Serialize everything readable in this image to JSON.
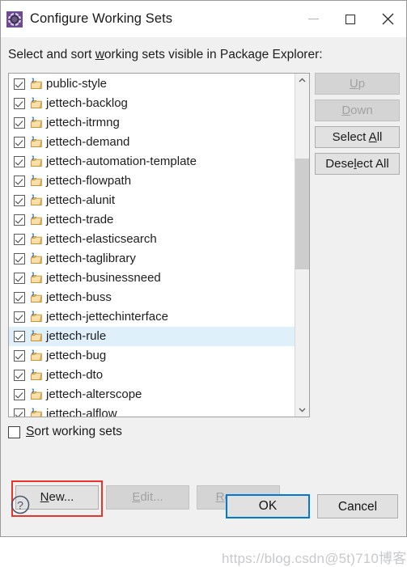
{
  "window": {
    "title": "Configure Working Sets",
    "icon": "gear-icon",
    "controls": {
      "minimize": "minimize-icon",
      "maximize": "maximize-icon",
      "close": "close-icon"
    }
  },
  "prompt": {
    "before": "Select and sort ",
    "mnemonic": "w",
    "after": "orking sets visible in Package Explorer:"
  },
  "list": {
    "items": [
      {
        "label": "public-style",
        "checked": true,
        "selected": false
      },
      {
        "label": "jettech-backlog",
        "checked": true,
        "selected": false
      },
      {
        "label": "jettech-itrmng",
        "checked": true,
        "selected": false
      },
      {
        "label": "jettech-demand",
        "checked": true,
        "selected": false
      },
      {
        "label": "jettech-automation-template",
        "checked": true,
        "selected": false
      },
      {
        "label": "jettech-flowpath",
        "checked": true,
        "selected": false
      },
      {
        "label": "jettech-alunit",
        "checked": true,
        "selected": false
      },
      {
        "label": "jettech-trade",
        "checked": true,
        "selected": false
      },
      {
        "label": "jettech-elasticsearch",
        "checked": true,
        "selected": false
      },
      {
        "label": "jettech-taglibrary",
        "checked": true,
        "selected": false
      },
      {
        "label": "jettech-businessneed",
        "checked": true,
        "selected": false
      },
      {
        "label": "jettech-buss",
        "checked": true,
        "selected": false
      },
      {
        "label": "jettech-jettechinterface",
        "checked": true,
        "selected": false
      },
      {
        "label": "jettech-rule",
        "checked": true,
        "selected": true
      },
      {
        "label": "jettech-bug",
        "checked": true,
        "selected": false
      },
      {
        "label": "jettech-dto",
        "checked": true,
        "selected": false
      },
      {
        "label": "jettech-alterscope",
        "checked": true,
        "selected": false
      },
      {
        "label": "jettech-alflow",
        "checked": true,
        "selected": false
      }
    ],
    "item_icon": "java-working-set-folder-icon",
    "scrollbar": {
      "up_arrow": "chevron-up-icon",
      "down_arrow": "chevron-down-icon"
    }
  },
  "side_buttons": [
    {
      "label_before": "",
      "mnemonic": "U",
      "label_after": "p",
      "name": "up-button",
      "disabled": true
    },
    {
      "label_before": "",
      "mnemonic": "D",
      "label_after": "own",
      "name": "down-button",
      "disabled": true
    },
    {
      "label_before": "Select ",
      "mnemonic": "A",
      "label_after": "ll",
      "name": "select-all-button",
      "disabled": false
    },
    {
      "label_before": "Dese",
      "mnemonic": "l",
      "label_after": "ect All",
      "name": "deselect-all-button",
      "disabled": false
    }
  ],
  "sort_checkbox": {
    "checked": false,
    "before": "",
    "mnemonic": "S",
    "after": "ort working sets"
  },
  "action_buttons": [
    {
      "before": "",
      "mnemonic": "N",
      "after": "ew...",
      "name": "new-button",
      "disabled": false,
      "highlighted": true
    },
    {
      "before": "",
      "mnemonic": "E",
      "after": "dit...",
      "name": "edit-button",
      "disabled": true,
      "highlighted": false
    },
    {
      "before": "",
      "mnemonic": "R",
      "after": "emove",
      "name": "remove-button",
      "disabled": true,
      "highlighted": false
    }
  ],
  "footer": {
    "help_icon": "help-icon",
    "ok_label": "OK",
    "cancel_label": "Cancel"
  },
  "watermark": {
    "text": "https://blog.csdn@5t)710博客"
  },
  "colors": {
    "selection": "#dff0fb",
    "focus_border": "#0078d7",
    "annotation": "#e8352c",
    "dialog_bg": "#f0f0f0"
  }
}
